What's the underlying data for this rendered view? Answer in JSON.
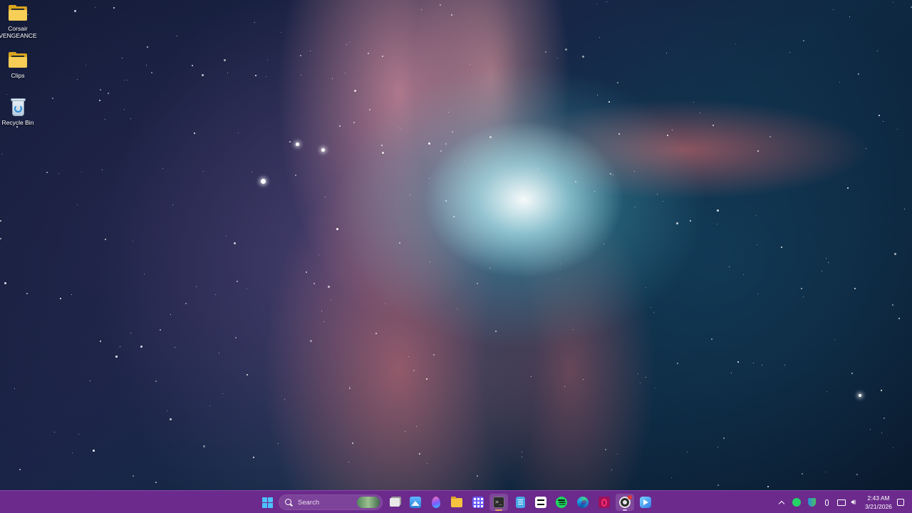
{
  "desktop": {
    "icons": [
      {
        "label": "Corsair VENGEANCE"
      },
      {
        "label": "Clips"
      },
      {
        "label": "Recycle Bin"
      }
    ]
  },
  "taskbar": {
    "color": "#6b2a8c",
    "search": {
      "label": "Search"
    },
    "pinned_apps": [
      "start-button",
      "search-box",
      "task-view",
      "photos",
      "paint-drop",
      "file-explorer",
      "app-grid",
      "terminal",
      "notepad",
      "capcut",
      "spotify",
      "edge",
      "opera-gx",
      "obs-studio",
      "bluestacks"
    ],
    "tray": {
      "icons": [
        "chevron-up-icon",
        "whatsapp-icon",
        "defender-icon",
        "microphone-icon",
        "network-icon",
        "volume-icon"
      ],
      "time": "2:43 AM",
      "date": "3/21/2026"
    }
  }
}
